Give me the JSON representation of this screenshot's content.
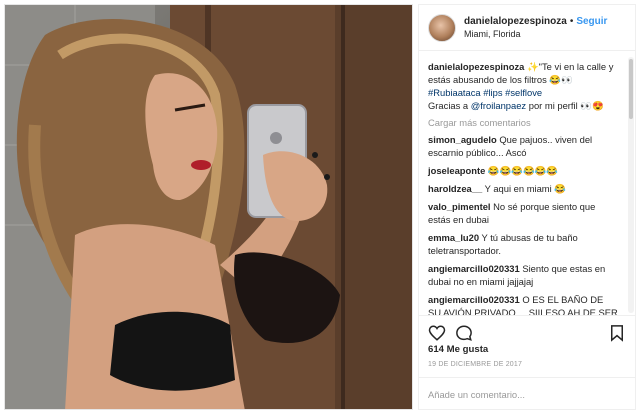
{
  "post": {
    "username": "danielalopezespinoza",
    "dot": "•",
    "follow_label": "Seguir",
    "location": "Miami, Florida",
    "caption": {
      "username": "danielalopezespinoza",
      "text_1": " ✨\"Te vi en la calle y estás abusando de los filtros 😂👀",
      "hashtags": "#Rubiaataca #lips #selflove",
      "text_2": "Gracias a ",
      "mention": "@froilanpaez",
      "text_3": " por mi perfil 👀😍"
    },
    "load_more_label": "Cargar más comentarios",
    "comments": [
      {
        "username": "simon_agudelo",
        "text": "Que pajuos.. viven del escarnio público... Ascó"
      },
      {
        "username": "joseleaponte",
        "text": "😂😂😂😂😂😂"
      },
      {
        "username": "haroldzea__",
        "text": "Y aqui en miami 😂"
      },
      {
        "username": "valo_pimentel",
        "text": "No sé porque siento que estás en dubai"
      },
      {
        "username": "emma_lu20",
        "text": "Y tú abusas de tu baño teletransportador."
      },
      {
        "username": "angiemarcillo020331",
        "text": "Siento que estas en dubai no en miami jajjajaj"
      },
      {
        "username": "angiemarcillo020331",
        "text": "O ES EL BAÑO DE SU AVIÓN PRIVADO ... SIII ESO AH DE SER ..... CADA QUE LLEGA A UN PAÍS SE"
      }
    ],
    "likes": "614 Me gusta",
    "date": "19 DE DICIEMBRE DE 2017",
    "comment_placeholder": "Añade un comentario...",
    "icons": {
      "like": "heart-icon",
      "comment": "comment-icon",
      "save": "bookmark-icon",
      "avatar": "avatar"
    }
  }
}
